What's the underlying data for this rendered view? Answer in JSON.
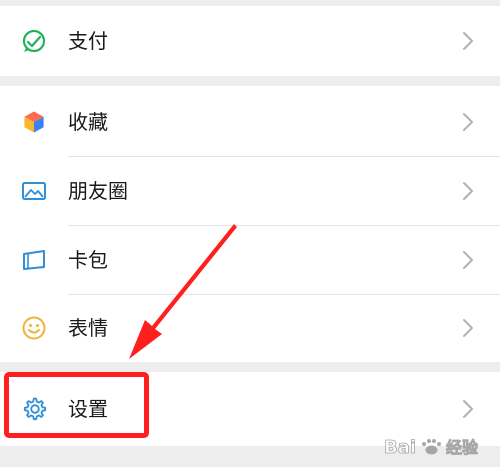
{
  "menu": {
    "items": [
      {
        "label": "支付",
        "icon": "wechat-pay-icon"
      },
      {
        "label": "收藏",
        "icon": "cube-favorites-icon"
      },
      {
        "label": "朋友圈",
        "icon": "picture-moments-icon"
      },
      {
        "label": "卡包",
        "icon": "card-wallet-icon"
      },
      {
        "label": "表情",
        "icon": "smiley-sticker-icon"
      },
      {
        "label": "设置",
        "icon": "gear-settings-icon"
      }
    ]
  },
  "annotation": {
    "highlight_color": "#ff1f1f",
    "highlighted_item": "设置"
  },
  "watermark": {
    "text": "Baidu经验"
  }
}
